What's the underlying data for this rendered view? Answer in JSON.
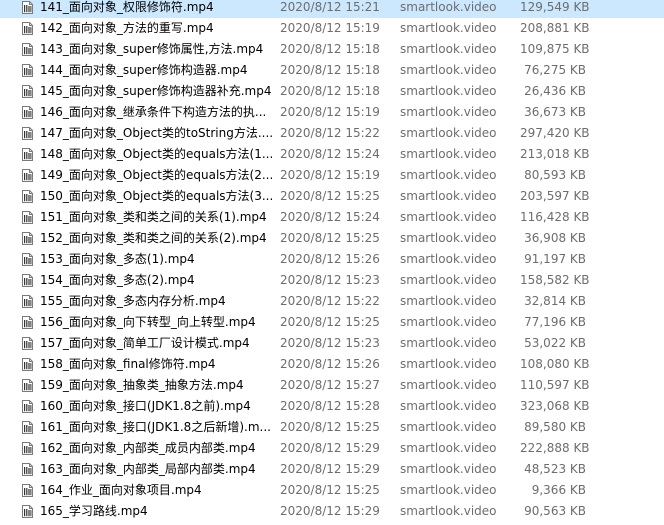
{
  "files": [
    {
      "name": "141_面向对象_权限修饰符.mp4",
      "date": "2020/8/12 15:21",
      "type": "smartlook.video",
      "size": "129,549 KB",
      "selected": true
    },
    {
      "name": "142_面向对象_方法的重写.mp4",
      "date": "2020/8/12 15:19",
      "type": "smartlook.video",
      "size": "208,881 KB"
    },
    {
      "name": "143_面向对象_super修饰属性,方法.mp4",
      "date": "2020/8/12 15:18",
      "type": "smartlook.video",
      "size": "109,875 KB"
    },
    {
      "name": "144_面向对象_super修饰构造器.mp4",
      "date": "2020/8/12 15:18",
      "type": "smartlook.video",
      "size": "76,275 KB"
    },
    {
      "name": "145_面向对象_super修饰构造器补充.mp4",
      "date": "2020/8/12 15:18",
      "type": "smartlook.video",
      "size": "26,436 KB"
    },
    {
      "name": "146_面向对象_继承条件下构造方法的执...",
      "date": "2020/8/12 15:19",
      "type": "smartlook.video",
      "size": "36,673 KB"
    },
    {
      "name": "147_面向对象_Object类的toString方法....",
      "date": "2020/8/12 15:22",
      "type": "smartlook.video",
      "size": "297,420 KB"
    },
    {
      "name": "148_面向对象_Object类的equals方法(1...",
      "date": "2020/8/12 15:24",
      "type": "smartlook.video",
      "size": "213,018 KB"
    },
    {
      "name": "149_面向对象_Object类的equals方法(2...",
      "date": "2020/8/12 15:19",
      "type": "smartlook.video",
      "size": "80,593 KB"
    },
    {
      "name": "150_面向对象_Object类的equals方法(3...",
      "date": "2020/8/12 15:25",
      "type": "smartlook.video",
      "size": "203,597 KB"
    },
    {
      "name": "151_面向对象_类和类之间的关系(1).mp4",
      "date": "2020/8/12 15:24",
      "type": "smartlook.video",
      "size": "116,428 KB"
    },
    {
      "name": "152_面向对象_类和类之间的关系(2).mp4",
      "date": "2020/8/12 15:25",
      "type": "smartlook.video",
      "size": "36,908 KB"
    },
    {
      "name": "153_面向对象_多态(1).mp4",
      "date": "2020/8/12 15:26",
      "type": "smartlook.video",
      "size": "91,197 KB"
    },
    {
      "name": "154_面向对象_多态(2).mp4",
      "date": "2020/8/12 15:23",
      "type": "smartlook.video",
      "size": "158,582 KB"
    },
    {
      "name": "155_面向对象_多态内存分析.mp4",
      "date": "2020/8/12 15:22",
      "type": "smartlook.video",
      "size": "32,814 KB"
    },
    {
      "name": "156_面向对象_向下转型_向上转型.mp4",
      "date": "2020/8/12 15:25",
      "type": "smartlook.video",
      "size": "77,196 KB"
    },
    {
      "name": "157_面向对象_简单工厂设计模式.mp4",
      "date": "2020/8/12 15:23",
      "type": "smartlook.video",
      "size": "53,022 KB"
    },
    {
      "name": "158_面向对象_final修饰符.mp4",
      "date": "2020/8/12 15:26",
      "type": "smartlook.video",
      "size": "108,080 KB"
    },
    {
      "name": "159_面向对象_抽象类_抽象方法.mp4",
      "date": "2020/8/12 15:27",
      "type": "smartlook.video",
      "size": "110,597 KB"
    },
    {
      "name": "160_面向对象_接口(JDK1.8之前).mp4",
      "date": "2020/8/12 15:28",
      "type": "smartlook.video",
      "size": "323,068 KB"
    },
    {
      "name": "161_面向对象_接口(JDK1.8之后新增).m...",
      "date": "2020/8/12 15:25",
      "type": "smartlook.video",
      "size": "89,580 KB"
    },
    {
      "name": "162_面向对象_内部类_成员内部类.mp4",
      "date": "2020/8/12 15:29",
      "type": "smartlook.video",
      "size": "222,888 KB"
    },
    {
      "name": "163_面向对象_内部类_局部内部类.mp4",
      "date": "2020/8/12 15:29",
      "type": "smartlook.video",
      "size": "48,523 KB"
    },
    {
      "name": "164_作业_面向对象项目.mp4",
      "date": "2020/8/12 15:25",
      "type": "smartlook.video",
      "size": "9,366 KB"
    },
    {
      "name": "165_学习路线.mp4",
      "date": "2020/8/12 15:29",
      "type": "smartlook.video",
      "size": "90,563 KB"
    }
  ]
}
